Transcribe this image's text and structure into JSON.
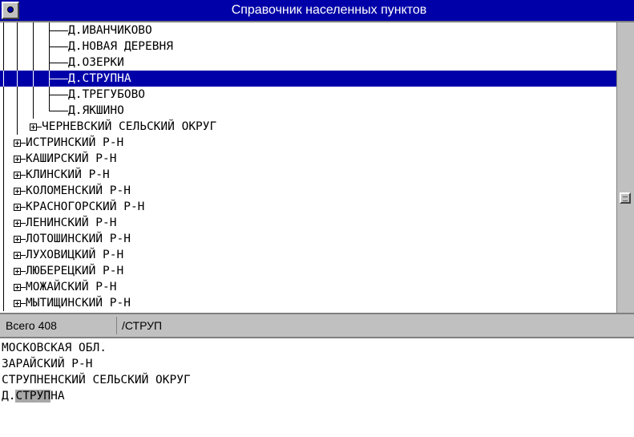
{
  "window": {
    "title": "Справочник населенных пунктов",
    "sysmenu_icon": "system-menu-icon"
  },
  "tree": {
    "rows": [
      {
        "label": "Д.ИВАНЧИКОВО",
        "level": 3,
        "expander": false,
        "selected": false
      },
      {
        "label": "Д.НОВАЯ ДЕРЕВНЯ",
        "level": 3,
        "expander": false,
        "selected": false
      },
      {
        "label": "Д.ОЗЕРКИ",
        "level": 3,
        "expander": false,
        "selected": false
      },
      {
        "label": "Д.СТРУПНА",
        "level": 3,
        "expander": false,
        "selected": true
      },
      {
        "label": "Д.ТРЕГУБОВО",
        "level": 3,
        "expander": false,
        "selected": false
      },
      {
        "label": "Д.ЯКШИНО",
        "level": 3,
        "expander": false,
        "selected": false
      },
      {
        "label": "ЧЕРНЕВСКИЙ СЕЛЬСКИЙ ОКРУГ",
        "level": 2,
        "expander": true,
        "selected": false
      },
      {
        "label": "ИСТРИНСКИЙ Р-Н",
        "level": 1,
        "expander": true,
        "selected": false
      },
      {
        "label": "КАШИРСКИЙ Р-Н",
        "level": 1,
        "expander": true,
        "selected": false
      },
      {
        "label": "КЛИНСКИЙ Р-Н",
        "level": 1,
        "expander": true,
        "selected": false
      },
      {
        "label": "КОЛОМЕНСКИЙ Р-Н",
        "level": 1,
        "expander": true,
        "selected": false
      },
      {
        "label": "КРАСНОГОРСКИЙ Р-Н",
        "level": 1,
        "expander": true,
        "selected": false
      },
      {
        "label": "ЛЕНИНСКИЙ Р-Н",
        "level": 1,
        "expander": true,
        "selected": false
      },
      {
        "label": "ЛОТОШИНСКИЙ Р-Н",
        "level": 1,
        "expander": true,
        "selected": false
      },
      {
        "label": "ЛУХОВИЦКИЙ Р-Н",
        "level": 1,
        "expander": true,
        "selected": false
      },
      {
        "label": "ЛЮБЕРЕЦКИЙ Р-Н",
        "level": 1,
        "expander": true,
        "selected": false
      },
      {
        "label": "МОЖАЙСКИЙ Р-Н",
        "level": 1,
        "expander": true,
        "selected": false
      },
      {
        "label": "МЫТИЩИНСКИЙ Р-Н",
        "level": 1,
        "expander": true,
        "selected": false
      }
    ]
  },
  "status": {
    "total": "Всего 408",
    "search": "/СТРУП"
  },
  "path": {
    "lines": [
      "МОСКОВСКАЯ ОБЛ.",
      "ЗАРАЙСКИЙ Р-Н",
      "СТРУПНЕНСКИЙ СЕЛЬСКИЙ ОКРУГ"
    ],
    "last_prefix": "Д.",
    "last_match": "СТРУП",
    "last_rest": "НА"
  },
  "colors": {
    "selection": "#0000a8",
    "title_bg": "#0000a8",
    "match_highlight": "#a8a8a8",
    "chrome": "#c0c0c0"
  }
}
